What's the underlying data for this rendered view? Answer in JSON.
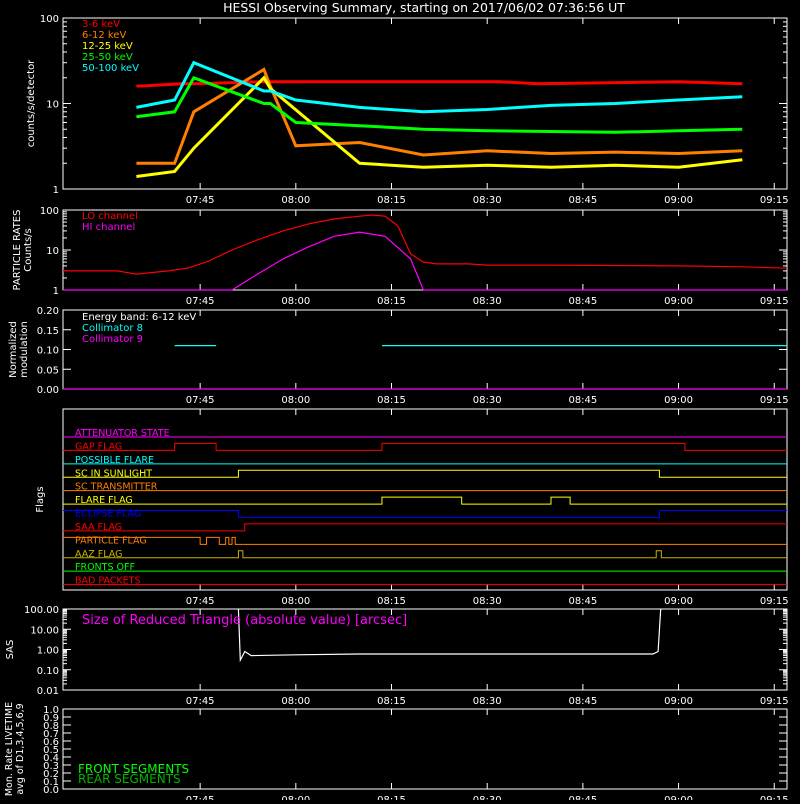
{
  "title": "HESSI Observing Summary, starting on 2017/06/02 07:36:56 UT",
  "colors": {
    "background": "#000000",
    "foreground": "#ffffff",
    "red": "#ff0000",
    "orange": "#ff8000",
    "yellow": "#ffff00",
    "green": "#00ff00",
    "cyan": "#00ffff",
    "magenta": "#ff00ff",
    "blue": "#0000ff",
    "olive": "#c8b400"
  },
  "time_axis": {
    "start_min": 443.5,
    "end_min": 557.0,
    "ticks": [
      465,
      480,
      495,
      510,
      525,
      540,
      555
    ],
    "tick_labels": [
      "07:45",
      "08:00",
      "08:15",
      "08:30",
      "08:45",
      "09:00",
      "09:15"
    ]
  },
  "chart_data": [
    {
      "type": "line",
      "name": "counts",
      "ylabel": "counts/s/detector",
      "yscale": "log",
      "ylim": [
        1,
        100
      ],
      "ytick_labels": [
        "1",
        "10",
        "100"
      ],
      "ytick_values": [
        1,
        10,
        100
      ],
      "legend": [
        "3-6 keV",
        "6-12 keV",
        "12-25 keV",
        "25-50 keV",
        "50-100 keV"
      ],
      "legend_placement": "top-left",
      "series": [
        {
          "name": "3-6 keV",
          "color": "red",
          "x": [
            455,
            456,
            462,
            464,
            475,
            476,
            486,
            512,
            518,
            540,
            550,
            568
          ],
          "y": [
            16,
            16,
            17,
            17,
            18,
            18,
            18,
            18,
            17,
            18,
            17,
            null
          ]
        },
        {
          "name": "6-12 keV",
          "color": "orange",
          "x": [
            455,
            461,
            464,
            475,
            476,
            480,
            490,
            500,
            510,
            520,
            530,
            540,
            550,
            560
          ],
          "y": [
            2,
            2,
            8,
            25,
            16,
            3.2,
            3.5,
            2.5,
            2.8,
            2.6,
            2.7,
            2.6,
            2.8,
            null
          ]
        },
        {
          "name": "12-25 keV",
          "color": "yellow",
          "x": [
            455,
            461,
            464,
            475,
            476,
            490,
            500,
            510,
            520,
            530,
            540,
            550,
            560
          ],
          "y": [
            1.4,
            1.6,
            3,
            20,
            15,
            2,
            1.8,
            1.9,
            1.8,
            1.9,
            1.8,
            2.2,
            null
          ]
        },
        {
          "name": "25-50 keV",
          "color": "green",
          "x": [
            455,
            461,
            464,
            475,
            476,
            480,
            490,
            500,
            510,
            520,
            530,
            540,
            550,
            560
          ],
          "y": [
            7,
            8,
            20,
            10,
            10,
            6,
            5.5,
            5,
            4.8,
            4.7,
            4.6,
            4.8,
            5,
            null
          ]
        },
        {
          "name": "50-100 keV",
          "color": "cyan",
          "x": [
            455,
            461,
            464,
            475,
            476,
            480,
            490,
            500,
            510,
            520,
            530,
            540,
            550,
            560
          ],
          "y": [
            9,
            11,
            30,
            14,
            14,
            11,
            9,
            8,
            8.5,
            9.5,
            10,
            11,
            12,
            null
          ]
        }
      ]
    },
    {
      "type": "line",
      "name": "particle-rates",
      "ylabel": "PARTICLE RATES Counts/s",
      "yscale": "log",
      "ylim": [
        1,
        100
      ],
      "ytick_labels": [
        "1",
        "10",
        "100"
      ],
      "ytick_values": [
        1,
        10,
        100
      ],
      "legend": [
        "LO channel",
        "HI channel"
      ],
      "legend_placement": "top-left",
      "series": [
        {
          "name": "LO channel",
          "color": "red",
          "x": [
            443.5,
            452,
            455,
            460,
            463,
            466,
            470,
            474,
            478,
            482,
            486,
            490,
            492,
            494,
            496,
            498,
            500,
            502,
            504,
            507,
            510,
            520,
            530,
            540,
            550,
            557
          ],
          "y": [
            3,
            3,
            2.5,
            3,
            3.5,
            5,
            10,
            18,
            30,
            45,
            60,
            70,
            75,
            70,
            40,
            8,
            5,
            4.5,
            4.5,
            4.5,
            4.2,
            4.2,
            4.1,
            4,
            3.8,
            3.5
          ]
        },
        {
          "name": "HI channel",
          "color": "magenta",
          "x": [
            443.5,
            470,
            474,
            478,
            482,
            486,
            490,
            494,
            498,
            500,
            557
          ],
          "y": [
            1,
            1,
            2.5,
            6,
            12,
            22,
            28,
            22,
            6,
            1,
            1
          ]
        }
      ]
    },
    {
      "type": "line",
      "name": "modulation",
      "ylabel": "Normalized modulation",
      "ylim": [
        0,
        0.2
      ],
      "ytick_labels": [
        "0.00",
        "0.05",
        "0.10",
        "0.15",
        "0.20"
      ],
      "ytick_values": [
        0,
        0.05,
        0.1,
        0.15,
        0.2
      ],
      "legend": [
        "Energy band: 6-12 keV",
        "Collimator 8",
        "Collimator 9"
      ],
      "legend_placement": "top-left",
      "series": [
        {
          "name": "Collimator 8",
          "color": "cyan",
          "x": [
            461,
            467.5
          ],
          "y": [
            0.11,
            0.11
          ]
        },
        {
          "name": "Collimator 8",
          "color": "cyan",
          "x": [
            493.5,
            580
          ],
          "y": [
            0.11,
            0.11
          ]
        },
        {
          "name": "Collimator 9",
          "color": "magenta",
          "x": [
            443.5,
            557
          ],
          "y": [
            0,
            0
          ]
        }
      ]
    },
    {
      "type": "line",
      "name": "flags",
      "ylabel": "Flags",
      "legend": [
        "ATTENUATOR STATE",
        "GAP FLAG",
        "POSSIBLE FLARE",
        "SC IN SUNLIGHT",
        "SC TRANSMITTER",
        "FLARE FLAG",
        "ECLIPSE FLAG",
        "SAA FLAG",
        "PARTICLE FLAG",
        "AAZ FLAG",
        "FRONTS OFF",
        "BAD PACKETS"
      ],
      "series": [
        {
          "name": "ATTENUATOR STATE",
          "color": "magenta",
          "steps": [
            [
              443.5,
              0
            ],
            [
              557,
              0
            ]
          ]
        },
        {
          "name": "GAP FLAG",
          "color": "red",
          "steps": [
            [
              443.5,
              0
            ],
            [
              461,
              1
            ],
            [
              467.5,
              0
            ],
            [
              493.5,
              1
            ],
            [
              541,
              0
            ]
          ]
        },
        {
          "name": "POSSIBLE FLARE",
          "color": "cyan",
          "steps": [
            [
              443.5,
              0
            ]
          ]
        },
        {
          "name": "SC IN SUNLIGHT",
          "color": "yellow",
          "steps": [
            [
              443.5,
              0
            ],
            [
              471,
              1
            ],
            [
              537,
              0
            ]
          ]
        },
        {
          "name": "SC TRANSMITTER",
          "color": "orange",
          "steps": [
            [
              443.5,
              0
            ]
          ]
        },
        {
          "name": "FLARE FLAG",
          "color": "yellow",
          "steps": [
            [
              443.5,
              0
            ],
            [
              493.5,
              1
            ],
            [
              506,
              0
            ],
            [
              520,
              1
            ],
            [
              523,
              0
            ]
          ]
        },
        {
          "name": "ECLIPSE FLAG",
          "color": "blue",
          "steps": [
            [
              443.5,
              1
            ],
            [
              471,
              0
            ],
            [
              537,
              1
            ]
          ]
        },
        {
          "name": "SAA FLAG",
          "color": "red",
          "steps": [
            [
              443.5,
              0
            ],
            [
              472,
              1
            ],
            [
              557,
              1
            ]
          ]
        },
        {
          "name": "PARTICLE FLAG",
          "color": "orange",
          "steps": [
            [
              443.5,
              1
            ],
            [
              465,
              0
            ],
            [
              466,
              1
            ],
            [
              468,
              0
            ],
            [
              469,
              1
            ],
            [
              469.5,
              0
            ],
            [
              470,
              1
            ],
            [
              470.5,
              0
            ]
          ]
        },
        {
          "name": "AAZ FLAG",
          "color": "olive",
          "steps": [
            [
              443.5,
              0
            ],
            [
              471,
              1
            ],
            [
              471.7,
              0
            ],
            [
              536.5,
              1
            ],
            [
              537.3,
              0
            ]
          ]
        },
        {
          "name": "FRONTS OFF",
          "color": "green",
          "steps": [
            [
              443.5,
              0
            ]
          ]
        },
        {
          "name": "BAD PACKETS",
          "color": "red",
          "steps": [
            [
              443.5,
              0
            ]
          ]
        }
      ]
    },
    {
      "type": "line",
      "name": "sas",
      "ylabel": "SAS",
      "yscale": "log",
      "ylim": [
        0.01,
        100
      ],
      "ytick_labels": [
        "0.01",
        "0.10",
        "1.00",
        "10.00",
        "100.00"
      ],
      "ytick_values": [
        0.01,
        0.1,
        1,
        10,
        100
      ],
      "legend": [
        "Size of Reduced Triangle (absolute value) [arcsec]"
      ],
      "legend_placement": "top-left",
      "series": [
        {
          "name": "Size of Reduced Triangle (absolute value) [arcsec]",
          "color": "white",
          "x": [
            471,
            471.3,
            472,
            473,
            480,
            490,
            500,
            510,
            520,
            530,
            536,
            536.8,
            537.2
          ],
          "y": [
            100,
            0.3,
            0.8,
            0.5,
            0.55,
            0.6,
            0.6,
            0.6,
            0.6,
            0.6,
            0.6,
            0.8,
            100
          ]
        }
      ]
    },
    {
      "type": "line",
      "name": "livetime",
      "ylabel": "Mon. Rate LIVETIME avg of D1,3,4,5,6,9",
      "ylim": [
        0,
        1
      ],
      "ytick_labels": [
        "0.0",
        "0.1",
        "0.2",
        "0.3",
        "0.4",
        "0.5",
        "0.6",
        "0.7",
        "0.8",
        "0.9",
        "1.0"
      ],
      "ytick_values": [
        0,
        0.1,
        0.2,
        0.3,
        0.4,
        0.5,
        0.6,
        0.7,
        0.8,
        0.9,
        1.0
      ],
      "legend": [
        "FRONT SEGMENTS",
        "REAR SEGMENTS"
      ],
      "legend_placement": "bottom-left",
      "series": []
    }
  ]
}
